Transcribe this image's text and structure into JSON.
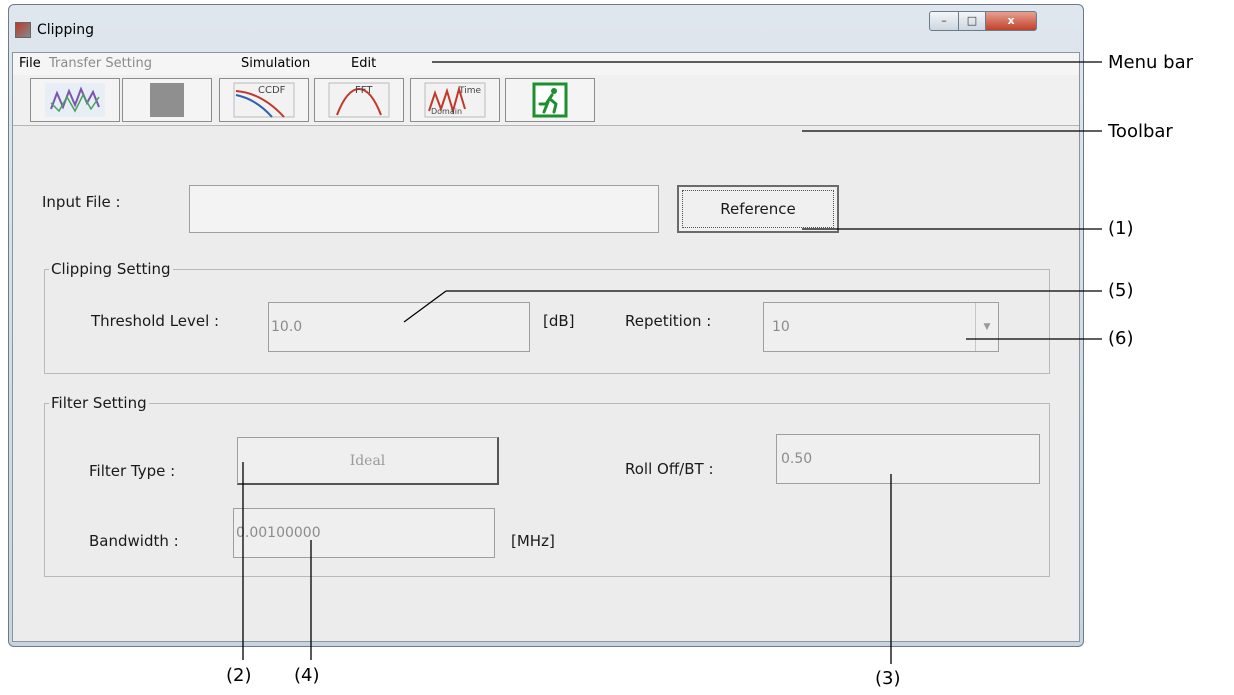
{
  "window": {
    "title": "Clipping",
    "close_symbol": "x",
    "min_symbol": "–",
    "max_symbol": "□"
  },
  "menu": [
    {
      "label": "File",
      "enabled": true
    },
    {
      "label": "Transfer Setting",
      "enabled": false
    },
    {
      "label": "Simulation",
      "enabled": true
    },
    {
      "label": "Edit",
      "enabled": true
    }
  ],
  "toolbar": {
    "tools": [
      {
        "icon": "waveform-icon"
      },
      {
        "icon": "gray-square-icon"
      },
      {
        "icon": "ccdf-icon",
        "text": "CCDF"
      },
      {
        "icon": "fft-icon",
        "text": "FFT"
      },
      {
        "icon": "time-domain-icon",
        "text": "Time",
        "subtext": "Domain"
      },
      {
        "icon": "exit-icon"
      }
    ]
  },
  "input_file": {
    "label": "Input File :",
    "value": "",
    "reference_label": "Reference"
  },
  "clipping": {
    "group_title": "Clipping Setting",
    "threshold_label": "Threshold Level :",
    "threshold_value": "10.0",
    "threshold_unit": "[dB]",
    "repetition_label": "Repetition :",
    "repetition_value": "10"
  },
  "filter": {
    "group_title": "Filter Setting",
    "type_label": "Filter Type :",
    "type_value": "Ideal",
    "rolloff_label": "Roll Off/BT :",
    "rolloff_value": "0.50",
    "bandwidth_label": "Bandwidth :",
    "bandwidth_value": "0.00100000",
    "bandwidth_unit": "[MHz]"
  },
  "annotations": {
    "menu_bar": "Menu bar",
    "toolbar": "Toolbar",
    "a1": "(1)",
    "a2": "(2)",
    "a3": "(3)",
    "a4": "(4)",
    "a5": "(5)",
    "a6": "(6)"
  },
  "colors": {
    "window_bg": "#ececec",
    "close_button": "#c0412a",
    "exit_green": "#1e8f2e"
  }
}
